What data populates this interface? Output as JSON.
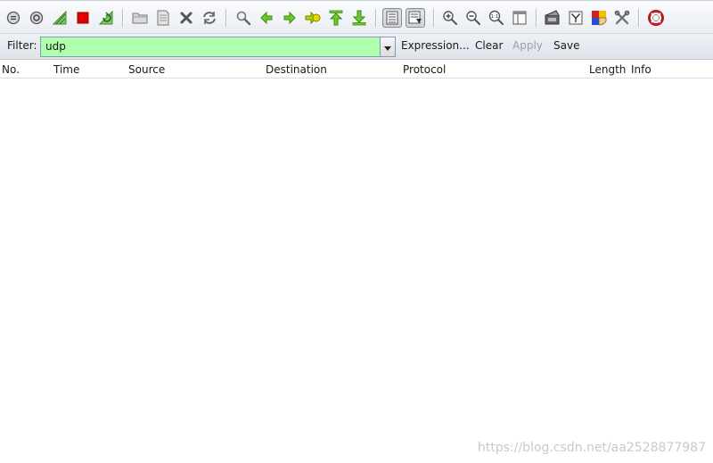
{
  "toolbar": {
    "buttons": [
      {
        "name": "interfaces-icon",
        "color": "#555555"
      },
      {
        "name": "capture-options-icon",
        "color": "#555555"
      },
      {
        "name": "start-capture-icon",
        "color": "#4caf50"
      },
      {
        "name": "stop-capture-icon",
        "color": "#e00000"
      },
      {
        "name": "restart-capture-icon",
        "color": "#4caf50"
      },
      {
        "name": "open-file-icon",
        "color": "#888888"
      },
      {
        "name": "save-file-icon",
        "color": "#888888"
      },
      {
        "name": "close-file-icon",
        "color": "#555555"
      },
      {
        "name": "reload-icon",
        "color": "#555555"
      },
      {
        "name": "find-packet-icon",
        "color": "#555555"
      },
      {
        "name": "go-back-icon",
        "color": "#55bb22"
      },
      {
        "name": "go-forward-icon",
        "color": "#55bb22"
      },
      {
        "name": "go-to-packet-icon",
        "color": "#8bc000"
      },
      {
        "name": "go-first-packet-icon",
        "color": "#55bb22"
      },
      {
        "name": "go-last-packet-icon",
        "color": "#55bb22"
      },
      {
        "name": "colorize-icon",
        "color": "#555555"
      },
      {
        "name": "auto-scroll-icon",
        "color": "#555555"
      },
      {
        "name": "zoom-in-icon",
        "color": "#555555"
      },
      {
        "name": "zoom-out-icon",
        "color": "#555555"
      },
      {
        "name": "normal-size-icon",
        "color": "#555555"
      },
      {
        "name": "resize-columns-icon",
        "color": "#555555"
      },
      {
        "name": "capture-filters-icon",
        "color": "#555555"
      },
      {
        "name": "display-filters-icon",
        "color": "#555555"
      },
      {
        "name": "coloring-rules-icon",
        "color": "#d02020"
      },
      {
        "name": "preferences-icon",
        "color": "#555555"
      },
      {
        "name": "help-icon",
        "color": "#d02020"
      }
    ]
  },
  "filter": {
    "label": "Filter:",
    "value": "udp",
    "valid_color": "#afffaf",
    "expression_label": "Expression...",
    "clear_label": "Clear",
    "apply_label": "Apply",
    "save_label": "Save"
  },
  "packet_list": {
    "columns": [
      "No.",
      "Time",
      "Source",
      "Destination",
      "Protocol",
      "Length",
      "Info"
    ]
  },
  "watermark": "https://blog.csdn.net/aa2528877987"
}
